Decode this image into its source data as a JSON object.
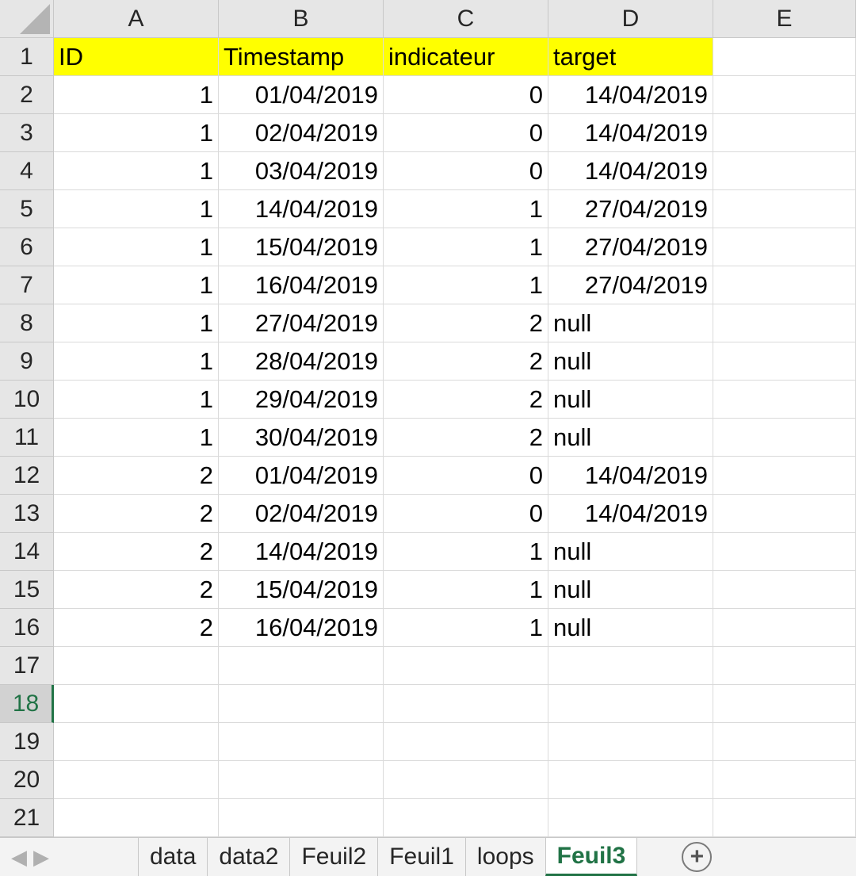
{
  "columns": [
    "A",
    "B",
    "C",
    "D",
    "E"
  ],
  "active_row": 18,
  "header_fill": "#ffff00",
  "accent": "#217346",
  "rows": [
    {
      "n": "1",
      "cells": [
        "ID",
        "Timestamp",
        "indicateur",
        "target",
        ""
      ]
    },
    {
      "n": "2",
      "cells": [
        "1",
        "01/04/2019",
        "0",
        "14/04/2019",
        ""
      ]
    },
    {
      "n": "3",
      "cells": [
        "1",
        "02/04/2019",
        "0",
        "14/04/2019",
        ""
      ]
    },
    {
      "n": "4",
      "cells": [
        "1",
        "03/04/2019",
        "0",
        "14/04/2019",
        ""
      ]
    },
    {
      "n": "5",
      "cells": [
        "1",
        "14/04/2019",
        "1",
        "27/04/2019",
        ""
      ]
    },
    {
      "n": "6",
      "cells": [
        "1",
        "15/04/2019",
        "1",
        "27/04/2019",
        ""
      ]
    },
    {
      "n": "7",
      "cells": [
        "1",
        "16/04/2019",
        "1",
        "27/04/2019",
        ""
      ]
    },
    {
      "n": "8",
      "cells": [
        "1",
        "27/04/2019",
        "2",
        "null",
        ""
      ]
    },
    {
      "n": "9",
      "cells": [
        "1",
        "28/04/2019",
        "2",
        "null",
        ""
      ]
    },
    {
      "n": "10",
      "cells": [
        "1",
        "29/04/2019",
        "2",
        "null",
        ""
      ]
    },
    {
      "n": "11",
      "cells": [
        "1",
        "30/04/2019",
        "2",
        "null",
        ""
      ]
    },
    {
      "n": "12",
      "cells": [
        "2",
        "01/04/2019",
        "0",
        "14/04/2019",
        ""
      ]
    },
    {
      "n": "13",
      "cells": [
        "2",
        "02/04/2019",
        "0",
        "14/04/2019",
        ""
      ]
    },
    {
      "n": "14",
      "cells": [
        "2",
        "14/04/2019",
        "1",
        "null",
        ""
      ]
    },
    {
      "n": "15",
      "cells": [
        "2",
        "15/04/2019",
        "1",
        "null",
        ""
      ]
    },
    {
      "n": "16",
      "cells": [
        "2",
        "16/04/2019",
        "1",
        "null",
        ""
      ]
    },
    {
      "n": "17",
      "cells": [
        "",
        "",
        "",
        "",
        ""
      ]
    },
    {
      "n": "18",
      "cells": [
        "",
        "",
        "",
        "",
        ""
      ]
    },
    {
      "n": "19",
      "cells": [
        "",
        "",
        "",
        "",
        ""
      ]
    },
    {
      "n": "20",
      "cells": [
        "",
        "",
        "",
        "",
        ""
      ]
    },
    {
      "n": "21",
      "cells": [
        "",
        "",
        "",
        "",
        ""
      ]
    }
  ],
  "tabbar": {
    "prev_icon": "◀",
    "next_icon": "▶",
    "tabs": [
      "data",
      "data2",
      "Feuil2",
      "Feuil1",
      "loops",
      "Feuil3"
    ],
    "active_tab": "Feuil3",
    "add_icon": "+"
  }
}
